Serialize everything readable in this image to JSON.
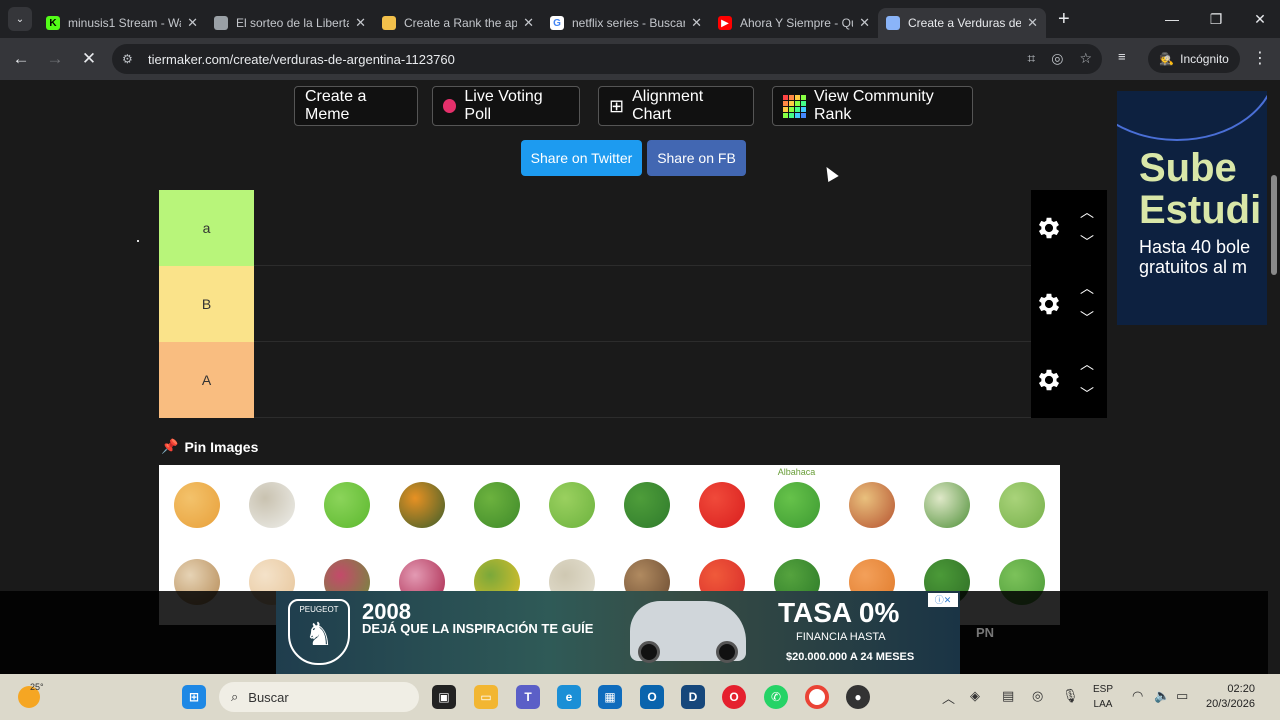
{
  "browser": {
    "tabs": [
      {
        "title": "minusis1 Stream - Wa",
        "fav_text": "K",
        "fav_color": "#53fc18",
        "fav_text_color": "#000"
      },
      {
        "title": "El sorteo de la Liberta",
        "fav_text": "",
        "fav_color": "#9aa0a6",
        "fav_text_color": "#000"
      },
      {
        "title": "Create a Rank the app",
        "fav_text": "",
        "fav_color": "#f2c04b",
        "fav_text_color": "#000"
      },
      {
        "title": "netflix series - Buscar",
        "fav_text": "G",
        "fav_color": "#ffffff",
        "fav_text_color": "#4285f4"
      },
      {
        "title": "Ahora Y Siempre - Qu",
        "fav_text": "▶",
        "fav_color": "#ff0000",
        "fav_text_color": "#fff"
      },
      {
        "title": "Create a Verduras de",
        "fav_text": "",
        "fav_color": "#8ab4f8",
        "fav_text_color": "#000",
        "active": true
      }
    ],
    "url": "tiermaker.com/create/verduras-de-argentina-1123760",
    "incognito_label": "Incógnito"
  },
  "page": {
    "buttons": {
      "meme": "Create a Meme",
      "poll": "Live Voting Poll",
      "alignment": "Alignment Chart",
      "community": "View Community Rank"
    },
    "share": {
      "twitter": "Share on Twitter",
      "fb": "Share on FB"
    },
    "tiers": [
      {
        "label": "a",
        "color": "#b8f57a"
      },
      {
        "label": "B",
        "color": "#fae38a"
      },
      {
        "label": "A",
        "color": "#f9bd80"
      }
    ],
    "pin_images": "Pin Images",
    "veg_caption": "Albahaca"
  },
  "ads": {
    "right": {
      "line1": "Sube",
      "line2": "Estudi",
      "line3": "Hasta 40 bole",
      "line4": "gratuitos al m"
    },
    "bottom": {
      "brand": "PEUGEOT",
      "model": "2008",
      "tagline": "DEJÁ QUE LA INSPIRACIÓN TE GUÍE",
      "rate": "TASA 0%",
      "financing": "FINANCIA HASTA",
      "amount": "$20.000.000 A 24 MESES",
      "side": "PN"
    }
  },
  "taskbar": {
    "weather": "25°",
    "search": "Buscar",
    "lang1": "ESP",
    "lang2": "LAA",
    "time": "02:20",
    "date": "20/3/2026"
  }
}
